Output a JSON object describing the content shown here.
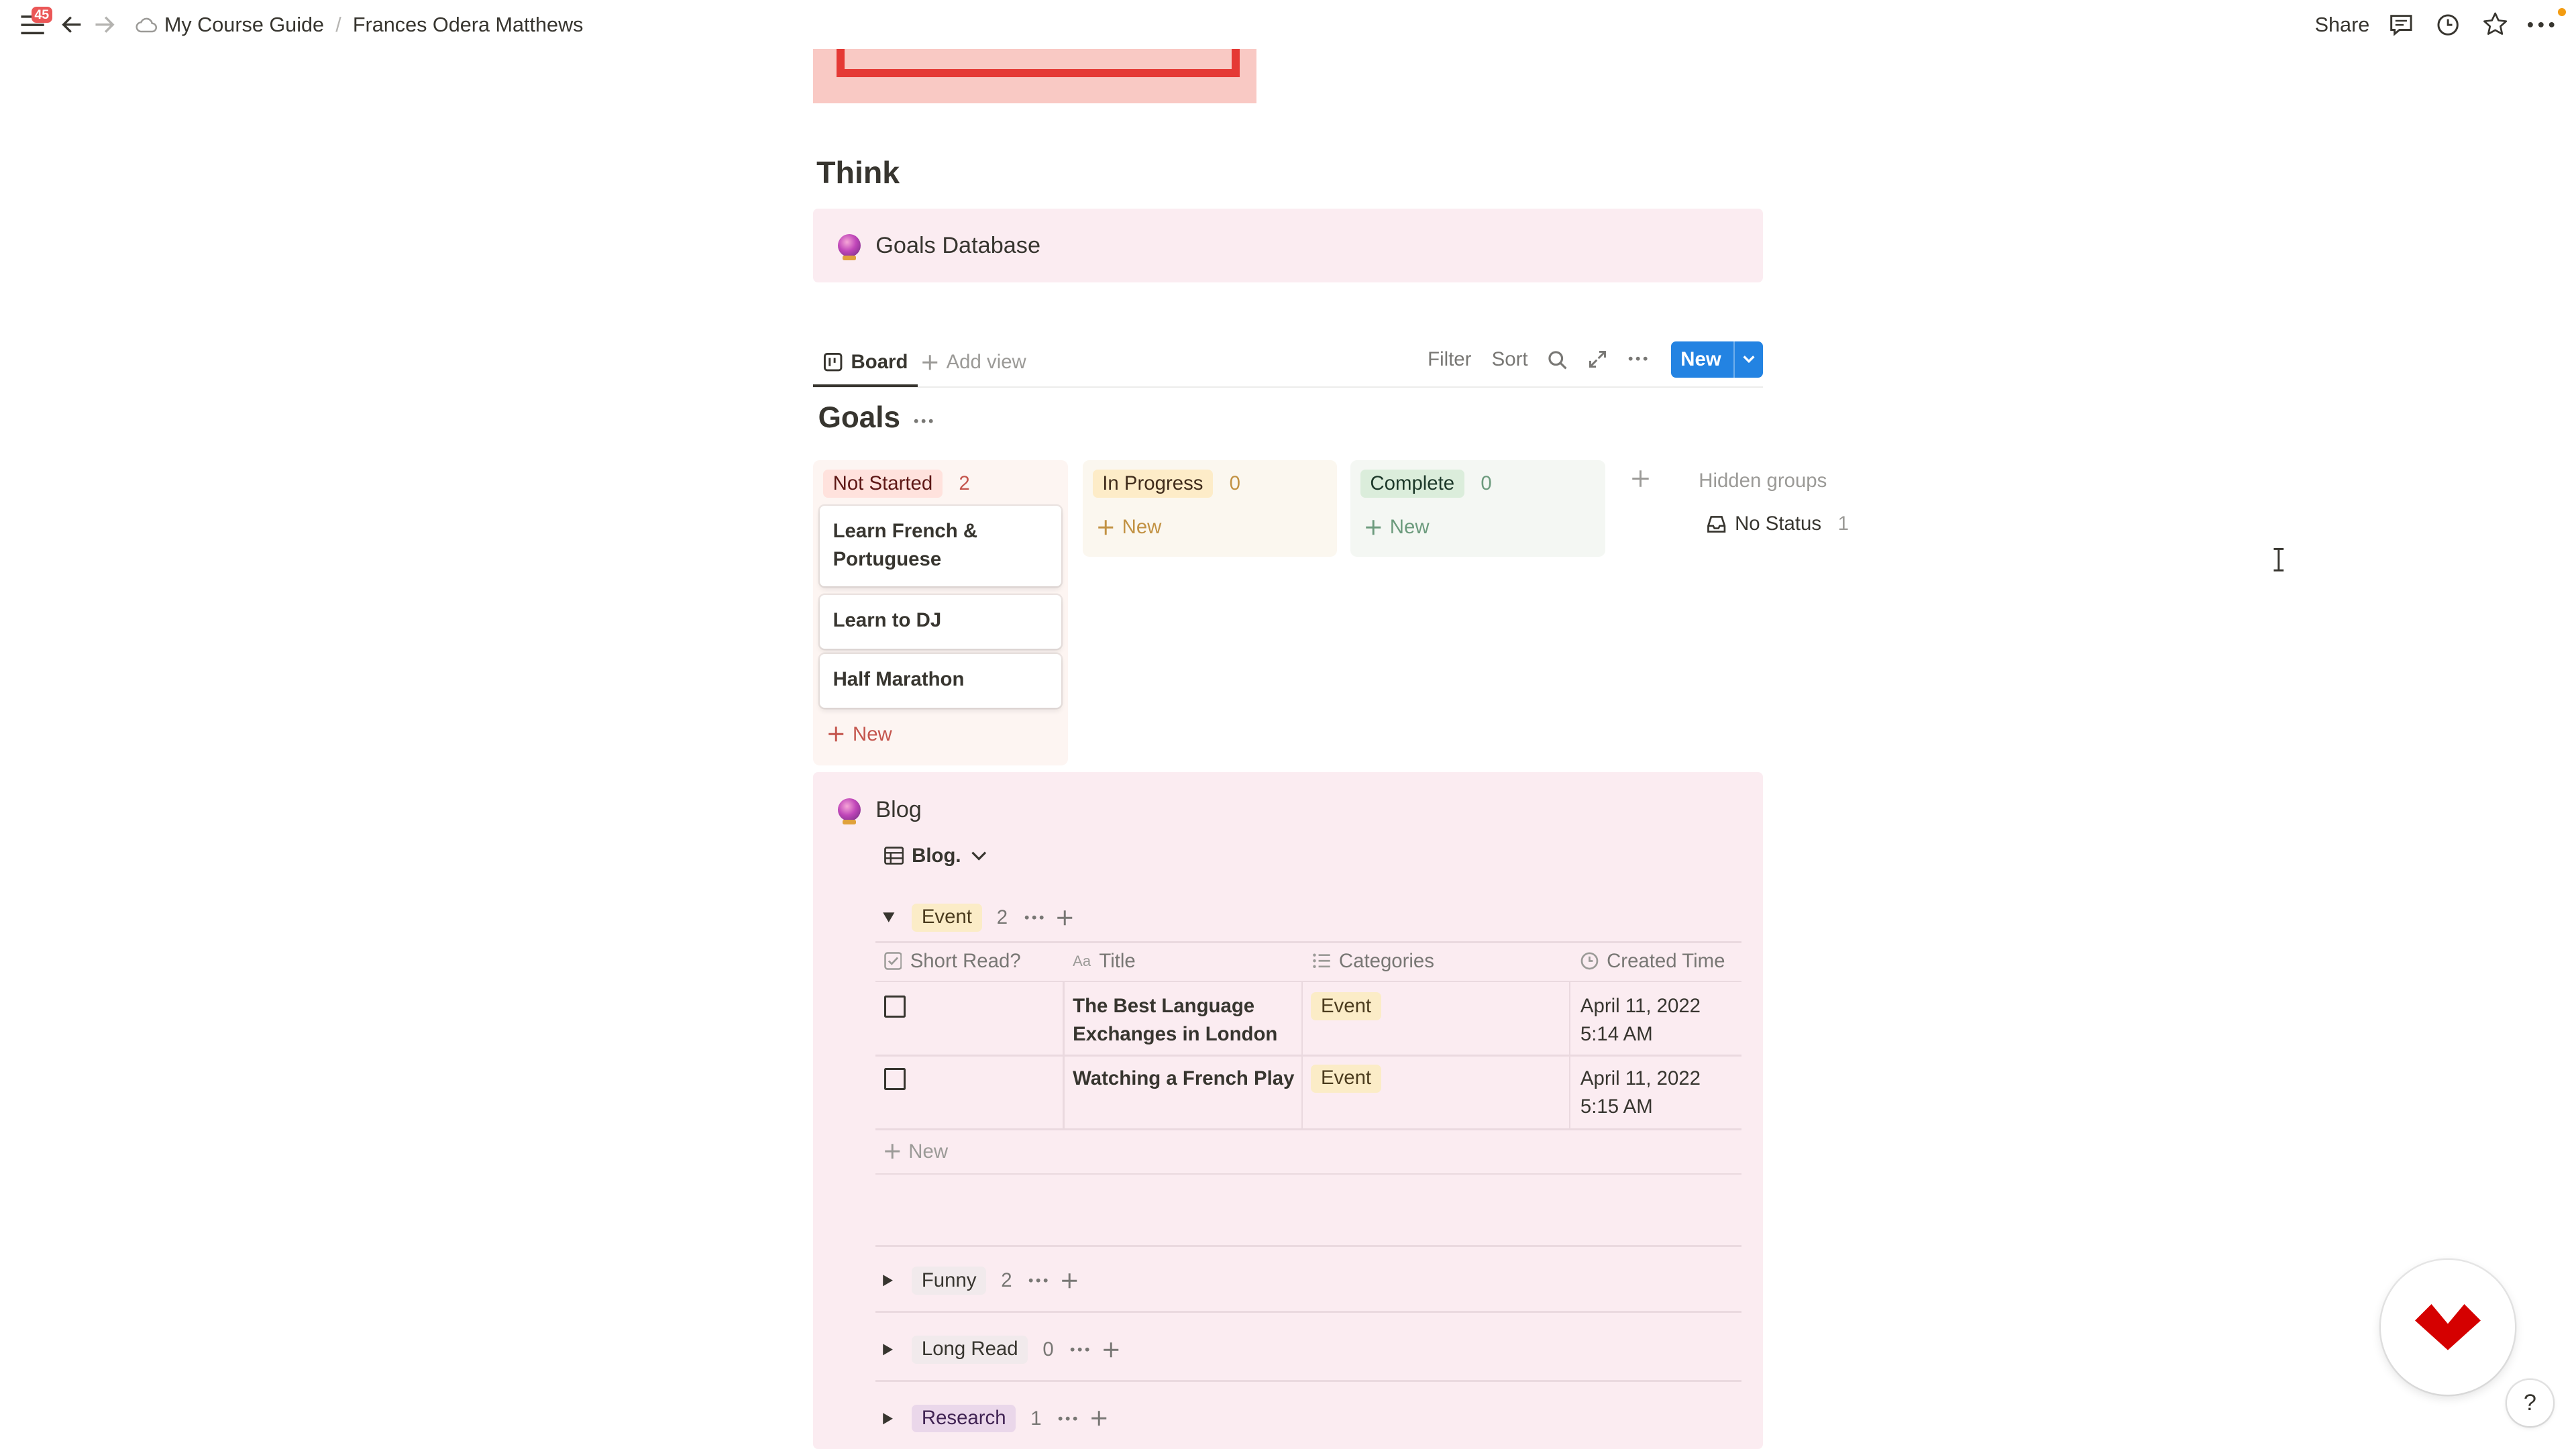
{
  "topbar": {
    "notification_count": "45",
    "breadcrumb": [
      "My Course Guide",
      "Frances Odera Matthews"
    ],
    "share_label": "Share"
  },
  "page": {
    "heading": "Think"
  },
  "goals_callout": {
    "title": "Goals Database"
  },
  "views": {
    "active_tab": "Board",
    "add_view_label": "Add view",
    "filter_label": "Filter",
    "sort_label": "Sort",
    "new_label": "New"
  },
  "board": {
    "title": "Goals",
    "columns": [
      {
        "name": "Not Started",
        "count": "2",
        "cards": [
          "Learn French & Portuguese",
          "Learn to DJ",
          "Half Marathon"
        ],
        "new_label": "New"
      },
      {
        "name": "In Progress",
        "count": "0",
        "cards": [],
        "new_label": "New"
      },
      {
        "name": "Complete",
        "count": "0",
        "cards": [],
        "new_label": "New"
      }
    ],
    "hidden_groups_label": "Hidden groups",
    "hidden_groups": [
      {
        "name": "No Status",
        "count": "1"
      }
    ]
  },
  "blog": {
    "title": "Blog",
    "view_name": "Blog.",
    "open_group": {
      "name": "Event",
      "count": "2"
    },
    "columns": [
      "Short Read?",
      "Title",
      "Categories",
      "Created Time"
    ],
    "rows": [
      {
        "short_read": false,
        "title": "The Best Language Exchanges in London",
        "category": "Event",
        "created": "April 11, 2022 5:14 AM"
      },
      {
        "short_read": false,
        "title": "Watching a French Play",
        "category": "Event",
        "created": "April 11, 2022 5:15 AM"
      }
    ],
    "new_label": "New",
    "collapsed_groups": [
      {
        "name": "Funny",
        "count": "2"
      },
      {
        "name": "Long Read",
        "count": "0"
      },
      {
        "name": "Research",
        "count": "1"
      }
    ]
  },
  "help_label": "?",
  "colors": {
    "accent_blue": "#2383e2",
    "callout_bg": "#fbecf1",
    "not_started_bg": "#ffe2dd",
    "in_progress_bg": "#fdecc8",
    "complete_bg": "#dbeddb",
    "logo_red": "#d50000"
  }
}
